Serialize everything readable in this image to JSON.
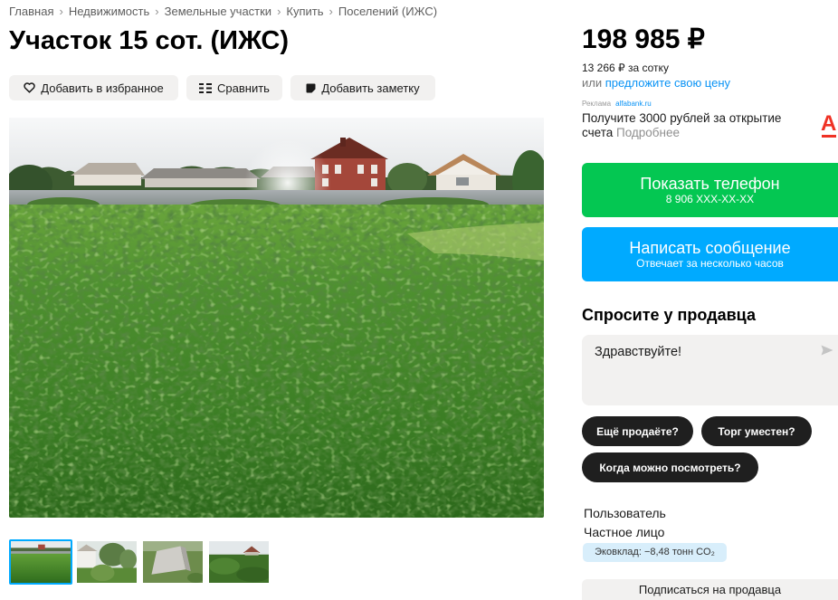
{
  "breadcrumb": {
    "separator": "›",
    "items": [
      "Главная",
      "Недвижимость",
      "Земельные участки",
      "Купить",
      "Поселений (ИЖС)"
    ]
  },
  "title": "Участок 15 сот. (ИЖС)",
  "actions": {
    "favorite_label": "Добавить в избранное",
    "compare_label": "Сравнить",
    "note_label": "Добавить заметку"
  },
  "gallery": {
    "selected_thumbnail": 0
  },
  "price": {
    "value": "198 985 ₽",
    "per_sotka": "13 266 ₽ за сотку",
    "offer_prefix": "или",
    "offer_link": "предложите свою цену"
  },
  "ad": {
    "label": "Реклама",
    "domain": "alfabank.ru",
    "text": "Получите 3000 рублей за открытие счета",
    "more_link": "Подробнее",
    "logo_letter": "А"
  },
  "contact": {
    "phone_label": "Показать телефон",
    "phone_masked": "8 906 XXX-XX-XX",
    "message_label": "Написать сообщение",
    "message_sub": "Отвечает за несколько часов"
  },
  "ask": {
    "heading": "Спросите у продавца",
    "message_value": "Здравствуйте!",
    "quick_questions": [
      "Ещё продаёте?",
      "Торг уместен?",
      "Когда можно посмотреть?"
    ]
  },
  "seller": {
    "name": "Пользователь",
    "type": "Частное лицо",
    "eco_badge": "Эковклад: −8,48 тонн CO₂",
    "subscribe_label": "Подписаться на продавца"
  },
  "icons": {
    "favorite": "heart-outline-icon",
    "compare": "compare-icon",
    "note": "note-icon",
    "send": "send-icon",
    "ad_logo": "alfa-bank-logo"
  },
  "colors": {
    "phone_button": "#04c752",
    "message_button": "#00aaff",
    "link": "#0a93f5",
    "chip": "#1f1f1f",
    "eco_badge": "#d8eefb",
    "alfa_red": "#ef3124",
    "selected_thumb": "#00aaff",
    "soft_bg": "#f2f1f0"
  }
}
